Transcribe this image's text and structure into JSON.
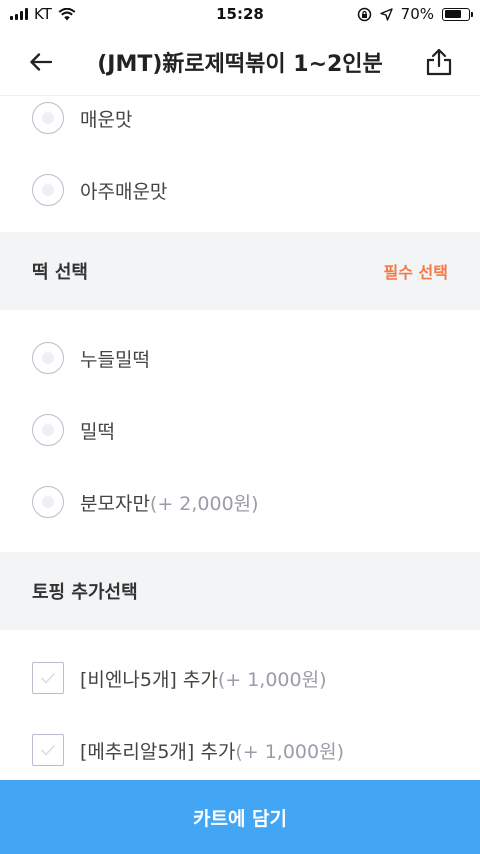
{
  "status_bar": {
    "carrier": "KT",
    "time": "15:28",
    "battery_text": "70%",
    "battery_level": 0.7
  },
  "header": {
    "title": "(JMT)新로제떡볶이 1~2인분",
    "back_icon": "back-arrow-icon",
    "share_icon": "share-icon"
  },
  "spice_options": [
    {
      "label": "매운맛",
      "extra": ""
    },
    {
      "label": "아주매운맛",
      "extra": ""
    }
  ],
  "rice_cake_section": {
    "title": "떡 선택",
    "required": "필수 선택",
    "options": [
      {
        "label": "누들밀떡",
        "extra": ""
      },
      {
        "label": "밀떡",
        "extra": ""
      },
      {
        "label": "분모자만",
        "extra": "(+ 2,000원)"
      }
    ]
  },
  "topping_section": {
    "title": "토핑 추가선택",
    "options": [
      {
        "label": "[비엔나5개] 추가",
        "extra": "(+ 1,000원)"
      },
      {
        "label": "[메추리알5개] 추가",
        "extra": "(+ 1,000원)"
      }
    ]
  },
  "cart_button": {
    "label": "카트에 담기"
  },
  "colors": {
    "accent_blue": "#43a6f4",
    "required_orange": "#f07a4a",
    "section_bg": "#f3f4f6"
  }
}
